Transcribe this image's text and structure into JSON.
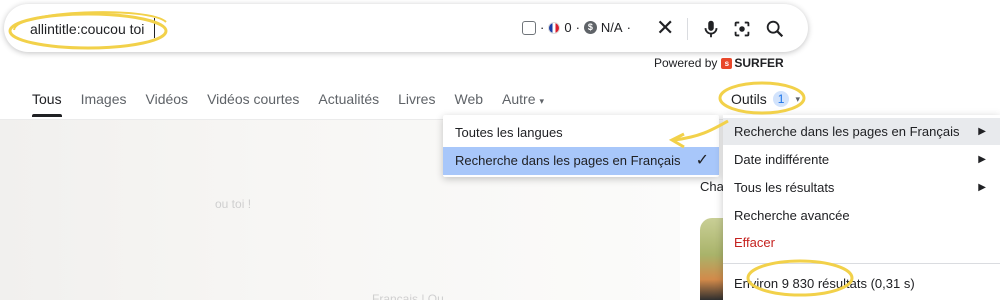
{
  "search": {
    "query": "allintitle:coucou toi"
  },
  "surfer": {
    "count": "0",
    "cpc": "N/A",
    "sep": "·",
    "powered_by": "Powered by",
    "brand": "SURFER"
  },
  "tabs": [
    {
      "label": "Tous",
      "active": true
    },
    {
      "label": "Images"
    },
    {
      "label": "Vidéos"
    },
    {
      "label": "Vidéos courtes"
    },
    {
      "label": "Actualités"
    },
    {
      "label": "Livres"
    },
    {
      "label": "Web"
    },
    {
      "label": "Autre",
      "dropdown": true
    }
  ],
  "outils": {
    "label": "Outils",
    "badge": "1"
  },
  "language_menu": {
    "items": [
      "Toutes les langues",
      "Recherche dans les pages en Français"
    ],
    "selected_index": 1
  },
  "tools_menu": {
    "items": [
      "Recherche dans les pages en Français",
      "Date indifférente",
      "Tous les résultats",
      "Recherche avancée",
      "Effacer"
    ],
    "result_stats": "Environ 9 830 résultats (0,31 s)"
  },
  "side_panel": {
    "label": "Cha"
  },
  "ghost_text": {
    "snippet": "ou toi !",
    "footer": "Français | Qu"
  },
  "colors": {
    "annotation": "#f2d14a",
    "selected_bg": "#a8c7fa",
    "danger": "#c5221f",
    "badge_bg": "#d2e3fc",
    "badge_fg": "#1a73e8"
  }
}
